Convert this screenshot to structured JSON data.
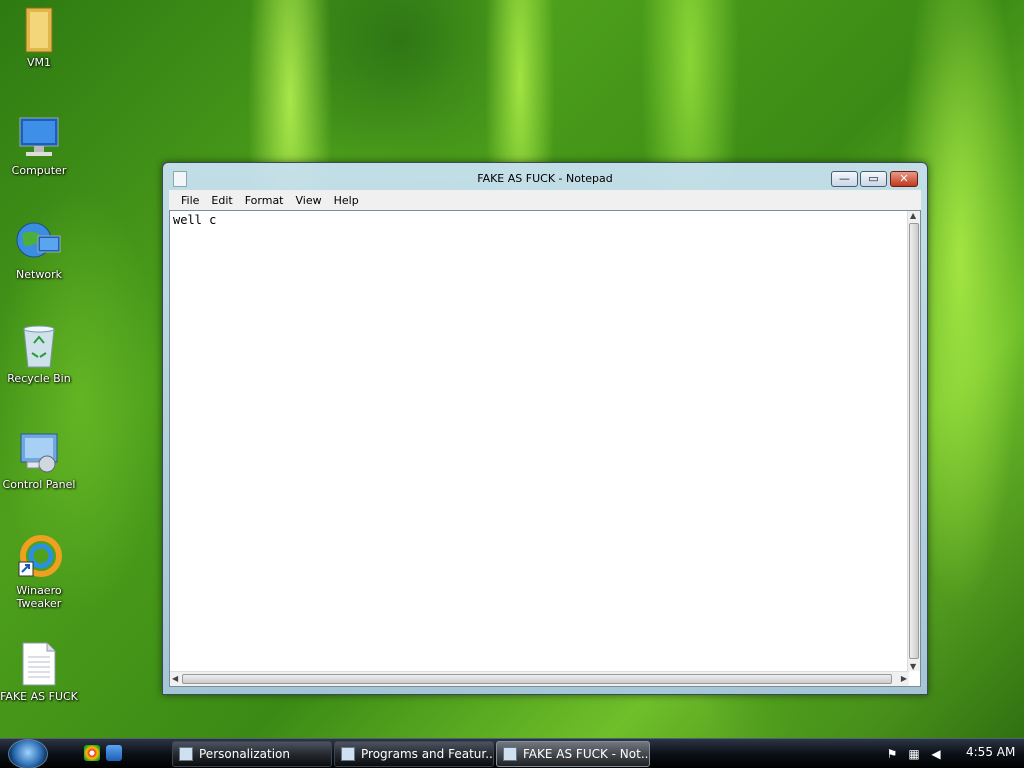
{
  "desktop": {
    "icons": [
      {
        "label": "VM1"
      },
      {
        "label": "Computer"
      },
      {
        "label": "Network"
      },
      {
        "label": "Recycle Bin"
      },
      {
        "label": "Control Panel"
      },
      {
        "label": "Winaero\nTweaker"
      },
      {
        "label": "FAKE AS FUCK"
      }
    ]
  },
  "notepad": {
    "title": "FAKE AS FUCK - Notepad",
    "menu": [
      "File",
      "Edit",
      "Format",
      "View",
      "Help"
    ],
    "content": "well c",
    "controls": {
      "minimize": "—",
      "maximize": "▭",
      "close": "✕"
    }
  },
  "taskbar": {
    "buttons": [
      {
        "label": "Personalization"
      },
      {
        "label": "Programs and Featur..."
      },
      {
        "label": "FAKE AS FUCK - Not..."
      }
    ],
    "clock": "4:55 AM"
  }
}
